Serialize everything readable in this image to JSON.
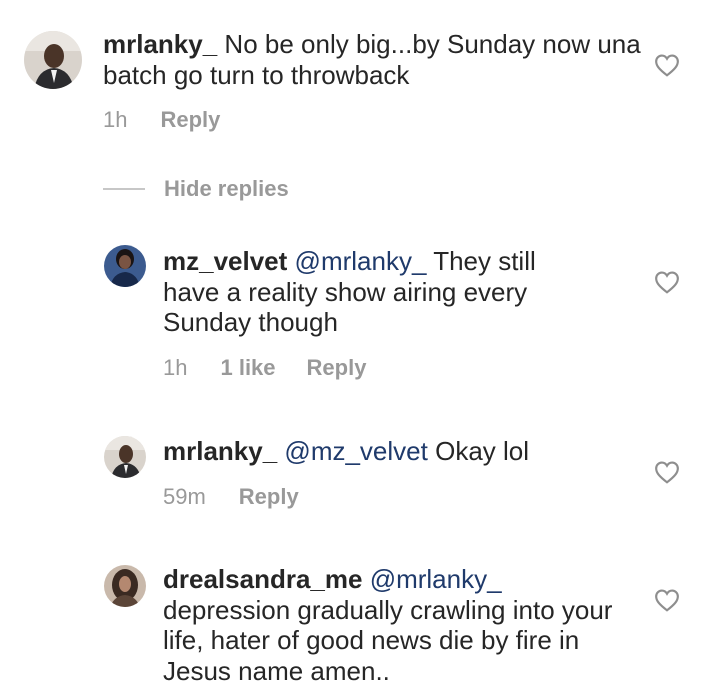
{
  "comments": [
    {
      "username": "mrlanky_",
      "mention": "",
      "text": "No be only big...by Sunday now una batch go turn to throwback",
      "time": "1h",
      "likes": "",
      "reply": "Reply"
    },
    {
      "username": "mz_velvet",
      "mention": "@mrlanky_",
      "text": "They still have a reality show airing every Sunday though",
      "time": "1h",
      "likes": "1 like",
      "reply": "Reply"
    },
    {
      "username": "mrlanky_",
      "mention": "@mz_velvet",
      "text": "Okay lol",
      "time": "59m",
      "likes": "",
      "reply": "Reply"
    },
    {
      "username": "drealsandra_me",
      "mention": "@mrlanky_",
      "text": "depression gradually crawling into your life, hater of good news die by fire in Jesus name amen..",
      "time": "",
      "likes": "",
      "reply": ""
    }
  ],
  "hide_replies": "Hide replies",
  "colors": {
    "text": "#262626",
    "muted": "#999999",
    "mention": "#1f3a6b",
    "divider": "#c7c7c7"
  },
  "icons": {
    "like": "heart-outline-icon",
    "avatar": "user-avatar"
  }
}
